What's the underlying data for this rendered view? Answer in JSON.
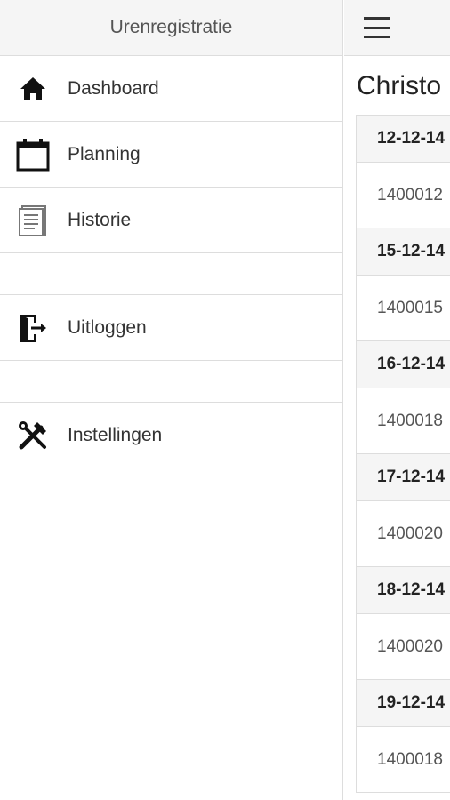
{
  "sidebar": {
    "title": "Urenregistratie",
    "items": [
      {
        "label": "Dashboard",
        "icon": "home-icon"
      },
      {
        "label": "Planning",
        "icon": "calendar-icon"
      },
      {
        "label": "Historie",
        "icon": "document-icon"
      },
      {
        "label": "Uitloggen",
        "icon": "logout-icon"
      },
      {
        "label": "Instellingen",
        "icon": "tools-icon"
      }
    ]
  },
  "main": {
    "title": "Christo",
    "entries": [
      {
        "date": "12-12-14",
        "value": "1400012"
      },
      {
        "date": "15-12-14",
        "value": "1400015"
      },
      {
        "date": "16-12-14",
        "value": "1400018"
      },
      {
        "date": "17-12-14",
        "value": "1400020"
      },
      {
        "date": "18-12-14",
        "value": "1400020"
      },
      {
        "date": "19-12-14",
        "value": "1400018"
      }
    ]
  }
}
